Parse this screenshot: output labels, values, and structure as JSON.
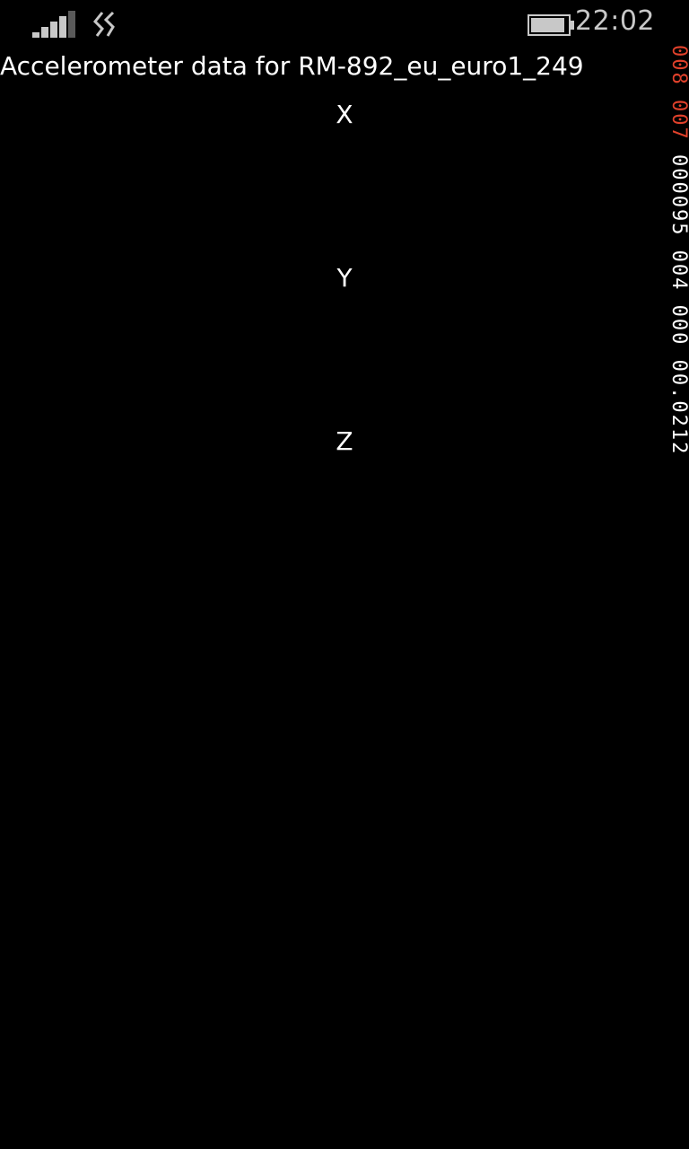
{
  "status_bar": {
    "time": "22:02",
    "signal_bars": 4,
    "battery_level": 0.85,
    "colors": {
      "icon": "#c8c8c8",
      "dim_icon": "#5a5a5a"
    }
  },
  "page": {
    "title": "Accelerometer data for RM-892_eu_euro1_249"
  },
  "axes": {
    "x_label": "X",
    "y_label": "Y",
    "z_label": "Z"
  },
  "debug_counter": {
    "red_text": "008 007",
    "white_text": "000095 004 000 00.0212",
    "colors": {
      "red": "#e0412b",
      "white": "#ffffff"
    }
  }
}
